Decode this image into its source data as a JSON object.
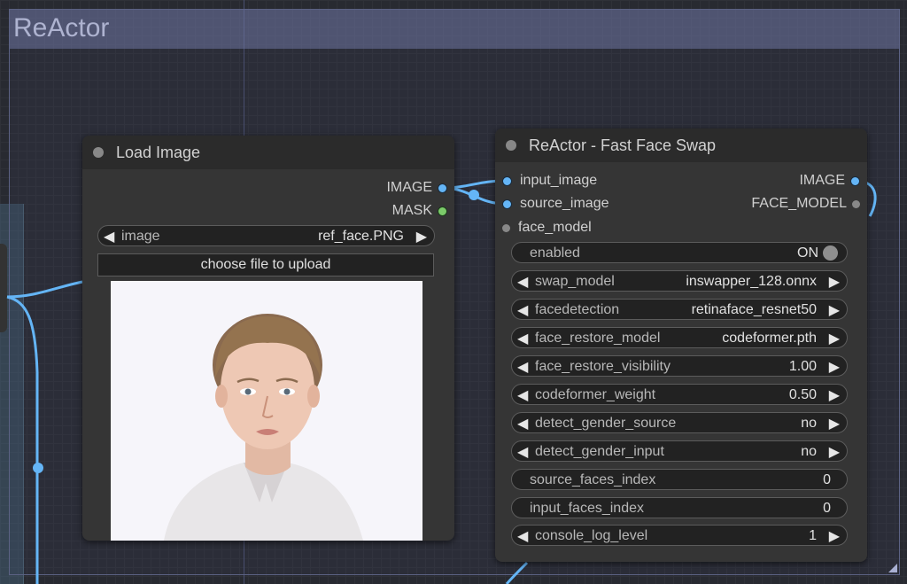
{
  "group": {
    "title": "ReActor"
  },
  "load_image": {
    "title": "Load Image",
    "outputs": [
      {
        "label": "IMAGE",
        "color": "#64b5f6"
      },
      {
        "label": "MASK",
        "color": "#7ccb6a"
      }
    ],
    "image_widget": {
      "name": "image",
      "value": "ref_face.PNG"
    },
    "upload_label": "choose file to upload"
  },
  "reactor": {
    "title": "ReActor - Fast Face Swap",
    "inputs": [
      {
        "label": "input_image"
      },
      {
        "label": "source_image"
      },
      {
        "label": "face_model"
      }
    ],
    "outputs": [
      {
        "label": "IMAGE"
      },
      {
        "label": "FACE_MODEL"
      }
    ],
    "widgets": [
      {
        "name": "enabled",
        "value": "ON"
      },
      {
        "name": "swap_model",
        "value": "inswapper_128.onnx"
      },
      {
        "name": "facedetection",
        "value": "retinaface_resnet50"
      },
      {
        "name": "face_restore_model",
        "value": "codeformer.pth"
      },
      {
        "name": "face_restore_visibility",
        "value": "1.00"
      },
      {
        "name": "codeformer_weight",
        "value": "0.50"
      },
      {
        "name": "detect_gender_source",
        "value": "no"
      },
      {
        "name": "detect_gender_input",
        "value": "no"
      },
      {
        "name": "source_faces_index",
        "value": "0"
      },
      {
        "name": "input_faces_index",
        "value": "0"
      },
      {
        "name": "console_log_level",
        "value": "1"
      }
    ]
  },
  "colors": {
    "link": "#64b5f6",
    "group": "#6e74a0"
  }
}
